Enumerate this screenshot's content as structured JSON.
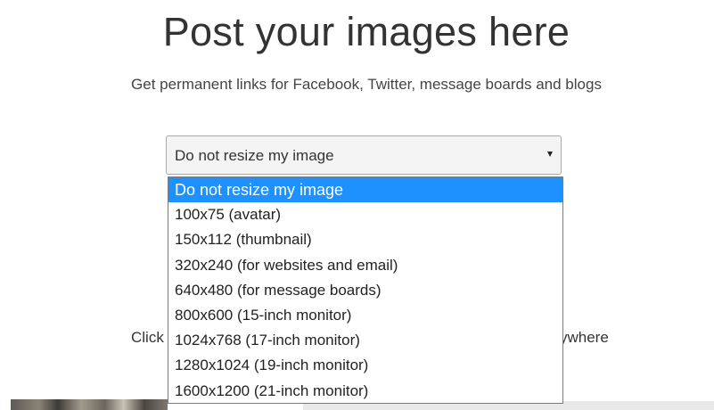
{
  "header": {
    "title": "Post your images here",
    "subtitle": "Get permanent links for Facebook, Twitter, message boards and blogs"
  },
  "resize_select": {
    "selected_value": "Do not resize my image",
    "options": [
      "Do not resize my image",
      "100x75 (avatar)",
      "150x112 (thumbnail)",
      "320x240 (for websites and email)",
      "640x480 (for message boards)",
      "800x600 (15-inch monitor)",
      "1024x768 (17-inch monitor)",
      "1280x1024 (19-inch monitor)",
      "1600x1200 (21-inch monitor)"
    ],
    "highlighted_index": 0
  },
  "upload_hint": {
    "left_fragment": "Click to",
    "right_fragment": "ywhere"
  },
  "colors": {
    "highlight": "#1e90ff",
    "text": "#333333"
  }
}
